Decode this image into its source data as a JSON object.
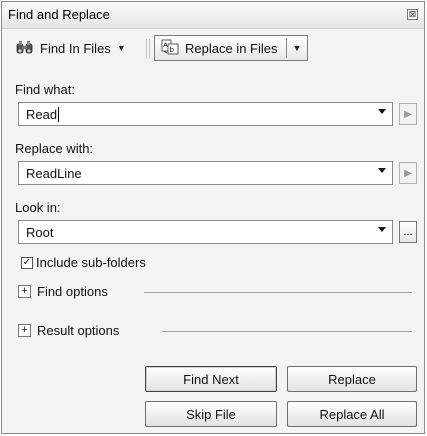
{
  "window": {
    "title": "Find and Replace",
    "close_glyph": "⊠"
  },
  "toolbar": {
    "find_in_files_label": "Find In Files",
    "replace_in_files_label": "Replace in Files",
    "find_in_files_icon": "binoculars-icon",
    "replace_in_files_icon": "replace-icon",
    "replace_in_files_pressed": true
  },
  "find": {
    "label": "Find what:",
    "value": "Read"
  },
  "replace": {
    "label": "Replace with:",
    "value": "ReadLine"
  },
  "look_in": {
    "label": "Look in:",
    "value": "Root",
    "browse_label": "..."
  },
  "include_subfolders": {
    "label": "Include sub-folders",
    "checked": true
  },
  "sections": {
    "find_options": "Find options",
    "result_options": "Result options",
    "expand_glyph": "+"
  },
  "buttons": {
    "find_next": "Find Next",
    "replace": "Replace",
    "skip_file": "Skip File",
    "replace_all": "Replace All"
  }
}
